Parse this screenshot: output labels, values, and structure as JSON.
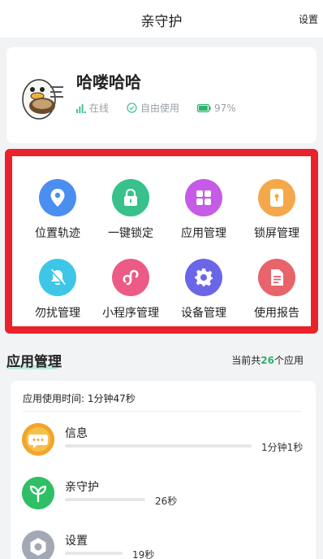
{
  "header": {
    "title": "亲守护",
    "settings_label": "设置"
  },
  "profile": {
    "name": "哈喽哈哈",
    "status_online": "在线",
    "status_mode": "自由使用",
    "battery_text": "97%",
    "battery_level": 0.97
  },
  "features": [
    {
      "label": "位置轨迹",
      "icon": "location-pin-icon",
      "color": "#4a8ef0"
    },
    {
      "label": "一键锁定",
      "icon": "padlock-icon",
      "color": "#36c28a"
    },
    {
      "label": "应用管理",
      "icon": "apps-grid-icon",
      "color": "#c55be6"
    },
    {
      "label": "锁屏管理",
      "icon": "lock-screen-phone-icon",
      "color": "#f5a84a"
    },
    {
      "label": "勿扰管理",
      "icon": "bell-off-icon",
      "color": "#3dc6e8"
    },
    {
      "label": "小程序管理",
      "icon": "mini-program-icon",
      "color": "#ec5a86"
    },
    {
      "label": "设备管理",
      "icon": "gear-icon",
      "color": "#6b66e8"
    },
    {
      "label": "使用报告",
      "icon": "report-document-icon",
      "color": "#e8636a"
    }
  ],
  "app_section": {
    "title": "应用管理",
    "count_prefix": "当前共",
    "count": "26",
    "count_suffix": "个应用"
  },
  "usage": {
    "title": "应用使用时间: 1分钟47秒",
    "apps": [
      {
        "name": "信息",
        "time": "1分钟1秒",
        "share": 1.0,
        "icon": "message-bubble-icon",
        "color": "#f2a52a"
      },
      {
        "name": "亲守护",
        "time": "26秒",
        "share": 0.43,
        "icon": "sprout-icon",
        "color": "#33c46a"
      },
      {
        "name": "设置",
        "time": "19秒",
        "share": 0.31,
        "icon": "settings-hex-icon",
        "color": "#a3a8b5"
      }
    ]
  }
}
